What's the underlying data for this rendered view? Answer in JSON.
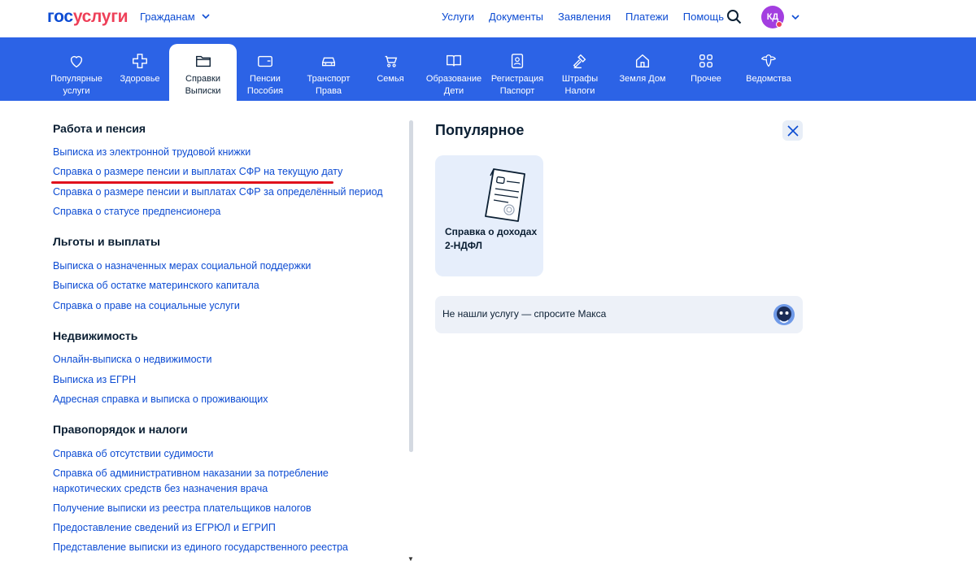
{
  "header": {
    "logo_part1": "гос",
    "logo_part2": "услуги",
    "audience": "Гражданам",
    "nav": [
      "Услуги",
      "Документы",
      "Заявления",
      "Платежи",
      "Помощь"
    ],
    "avatar_initials": "КД"
  },
  "categories": [
    {
      "line1": "Популярные",
      "line2": "услуги",
      "icon": "heart-icon"
    },
    {
      "line1": "Здоровье",
      "line2": "",
      "icon": "health-cross-icon"
    },
    {
      "line1": "Справки",
      "line2": "Выписки",
      "icon": "folder-icon",
      "active": true
    },
    {
      "line1": "Пенсии",
      "line2": "Пособия",
      "icon": "wallet-icon"
    },
    {
      "line1": "Транспорт",
      "line2": "Права",
      "icon": "car-icon"
    },
    {
      "line1": "Семья",
      "line2": "",
      "icon": "stroller-icon"
    },
    {
      "line1": "Образование",
      "line2": "Дети",
      "icon": "book-icon"
    },
    {
      "line1": "Регистрация",
      "line2": "Паспорт",
      "icon": "id-card-icon"
    },
    {
      "line1": "Штрафы",
      "line2": "Налоги",
      "icon": "gavel-icon"
    },
    {
      "line1": "Земля Дом",
      "line2": "",
      "icon": "house-icon"
    },
    {
      "line1": "Прочее",
      "line2": "",
      "icon": "grid-icon"
    },
    {
      "line1": "Ведомства",
      "line2": "",
      "icon": "emblem-icon"
    }
  ],
  "sections": [
    {
      "title": "Работа и пенсия",
      "links": [
        "Выписка из электронной трудовой книжки",
        "Справка о размере пенсии и выплатах СФР на текущую дату",
        "Справка о размере пенсии и выплатах СФР за определённый период",
        "Справка о статусе предпенсионера"
      ]
    },
    {
      "title": "Льготы и выплаты",
      "links": [
        "Выписка о назначенных мерах социальной поддержки",
        "Выписка об остатке материнского капитала",
        "Справка о праве на социальные услуги"
      ]
    },
    {
      "title": "Недвижимость",
      "links": [
        "Онлайн-выписка о недвижимости",
        "Выписка из ЕГРН",
        "Адресная справка и выписка о проживающих"
      ]
    },
    {
      "title": "Правопорядок и налоги",
      "links": [
        "Справка об отсутствии судимости",
        "Справка об административном наказании за потребление наркотических средств без назначения врача",
        "Получение выписки из реестра плательщиков налогов",
        "Предоставление сведений из ЕГРЮЛ и ЕГРИП",
        "Представление выписки из единого государственного реестра"
      ]
    }
  ],
  "popular": {
    "title": "Популярное",
    "card": "Справка о доходах 2-НДФЛ",
    "ask": "Не нашли услугу — спросите Макса"
  },
  "colors": {
    "brand_blue": "#0d4cd3",
    "band_blue": "#2c63e6",
    "brand_red": "#ee3f58",
    "highlight_red": "#e0101b",
    "avatar_purple": "#a33ee0"
  }
}
